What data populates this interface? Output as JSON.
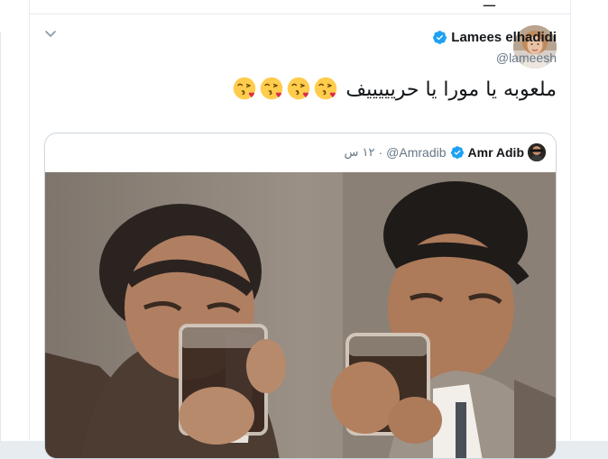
{
  "tweet": {
    "author": {
      "display_name": "Lamees elhadidi",
      "handle": "@lameesh",
      "verified": true
    },
    "text": "ملعوبه يا مورا يا حريييييف",
    "emojis": [
      "kissing-face-with-heart",
      "kissing-face-with-heart",
      "kissing-face-with-heart",
      "kissing-face-with-heart"
    ],
    "quoted_tweet": {
      "display_name": "Amr Adib",
      "handle": "@Amradib",
      "verified": true,
      "separator": "·",
      "time": "١٢ س",
      "media": "photo of two men drinking from glasses"
    }
  },
  "colors": {
    "verified": "#1da1f2",
    "text": "#14171a",
    "secondary": "#657786",
    "border": "#ccd6dd"
  },
  "icons": {
    "menu": "chevron-down-icon",
    "badge": "verified-badge-icon"
  }
}
